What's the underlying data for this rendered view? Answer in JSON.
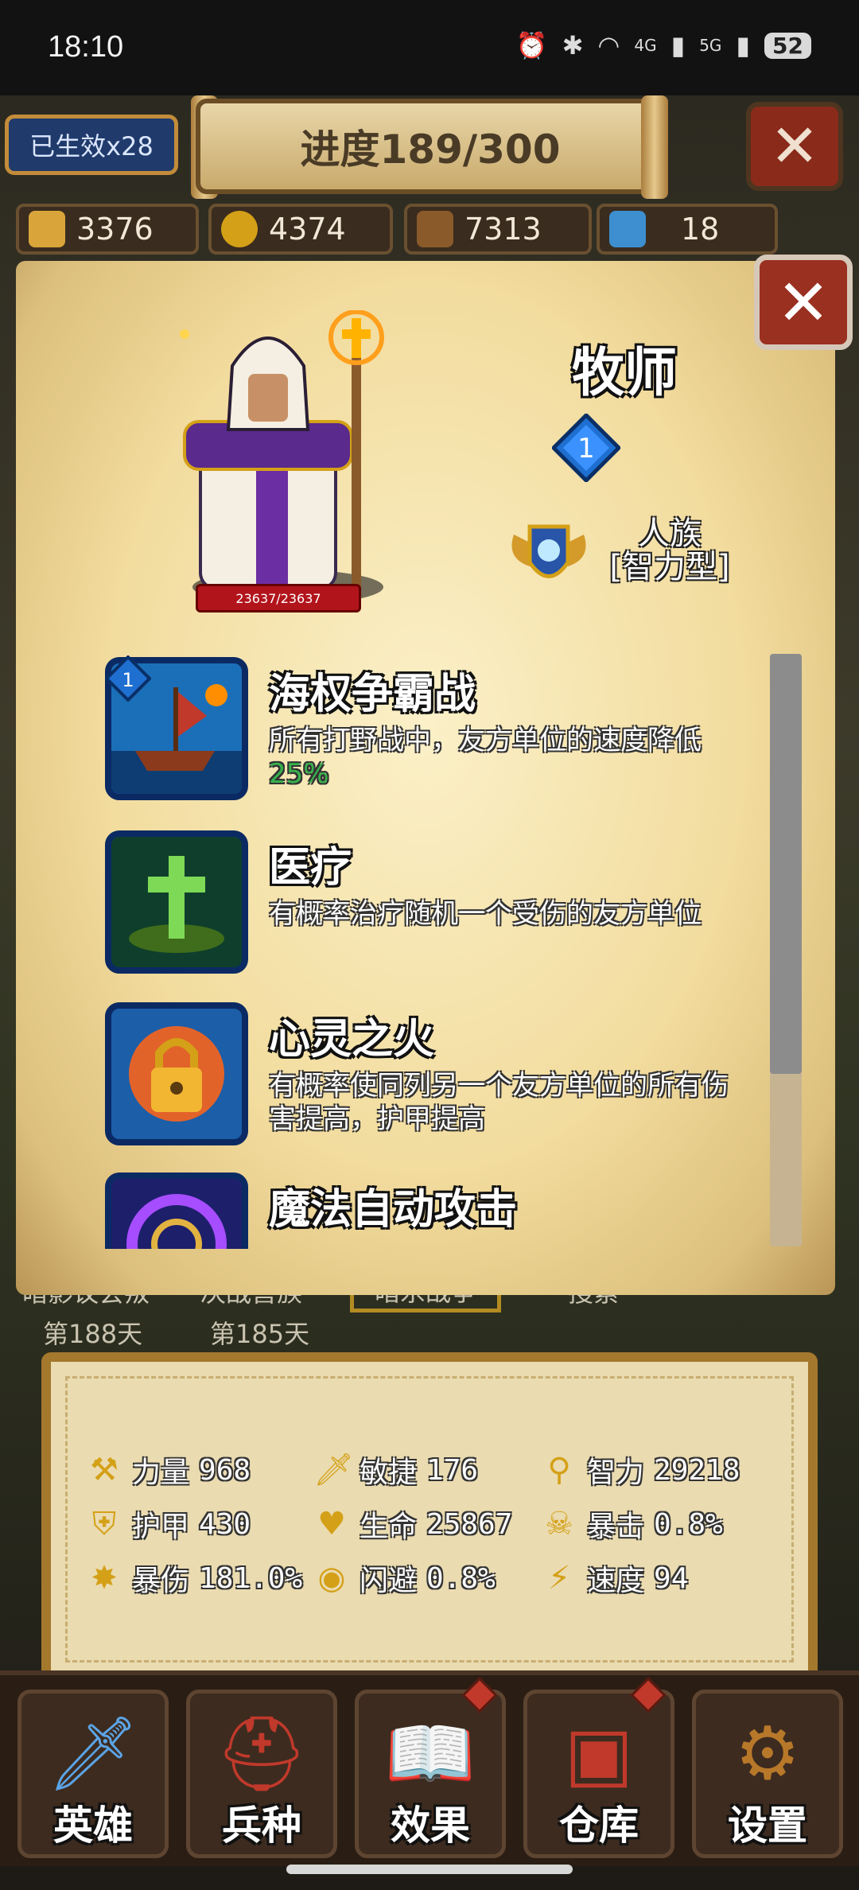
{
  "status_bar": {
    "time": "18:10",
    "battery": "52",
    "network_labels": [
      "4G",
      "5G"
    ]
  },
  "top_bar": {
    "buff_label": "已生效x28",
    "progress": "进度189/300"
  },
  "resources": [
    {
      "value": "3376",
      "icon": "population-icon"
    },
    {
      "value": "4374",
      "icon": "gold-coins-icon"
    },
    {
      "value": "7313",
      "icon": "wood-logs-icon"
    },
    {
      "value": "18",
      "icon": "magic-key-icon"
    }
  ],
  "hero": {
    "name": "牧师",
    "level": "1",
    "hp": "23637/23637",
    "race_line1": "人族",
    "race_line2": "[智力型]"
  },
  "skills": [
    {
      "title": "海权争霸战",
      "desc_before": "所有打野战中，友方单位的速度降低",
      "desc_highlight": "25%",
      "level": "1",
      "icon": "pirate-ship-icon"
    },
    {
      "title": "医疗",
      "desc_before": "有概率治疗随机一个受伤的友方单位",
      "desc_highlight": "",
      "icon": "healing-cross-icon"
    },
    {
      "title": "心灵之火",
      "desc_before": "有概率使同列另一个友方单位的所有伤害提高，护甲提高",
      "desc_highlight": "",
      "icon": "inner-fire-lock-icon"
    },
    {
      "title": "魔法自动攻击",
      "desc_before": "",
      "desc_highlight": "",
      "icon": "arcane-vortex-icon"
    }
  ],
  "story_tabs": [
    {
      "title": "暗影议会叛",
      "day": "第188天"
    },
    {
      "title": "决战兽族",
      "day": "第185天"
    },
    {
      "title": "暗杀战争",
      "day": ""
    },
    {
      "title": "搜索",
      "day": ""
    }
  ],
  "stats": [
    {
      "label": "力量",
      "value": "968",
      "icon": "axe-icon"
    },
    {
      "label": "敏捷",
      "value": "176",
      "icon": "sword-icon"
    },
    {
      "label": "智力",
      "value": "29218",
      "icon": "staff-icon"
    },
    {
      "label": "护甲",
      "value": "430",
      "icon": "shield-icon"
    },
    {
      "label": "生命",
      "value": "25867",
      "icon": "heart-icon"
    },
    {
      "label": "暴击",
      "value": "0.8%",
      "icon": "skull-icon"
    },
    {
      "label": "暴伤",
      "value": "181.0%",
      "icon": "explosion-icon"
    },
    {
      "label": "闪避",
      "value": "0.8%",
      "icon": "eye-icon"
    },
    {
      "label": "速度",
      "value": "94",
      "icon": "lightning-icon"
    }
  ],
  "nav": [
    {
      "label": "英雄",
      "icon": "sword-icon",
      "alert": false
    },
    {
      "label": "兵种",
      "icon": "helmet-icon",
      "alert": false
    },
    {
      "label": "效果",
      "icon": "spellbook-icon",
      "alert": true
    },
    {
      "label": "仓库",
      "icon": "treasure-chest-icon",
      "alert": true
    },
    {
      "label": "设置",
      "icon": "gear-icon",
      "alert": false
    }
  ],
  "colors": {
    "parchment": "#f2dc9e",
    "skill_frame": "#154a9c",
    "highlight": "#37b24d",
    "hp_bar": "#b2141c"
  }
}
